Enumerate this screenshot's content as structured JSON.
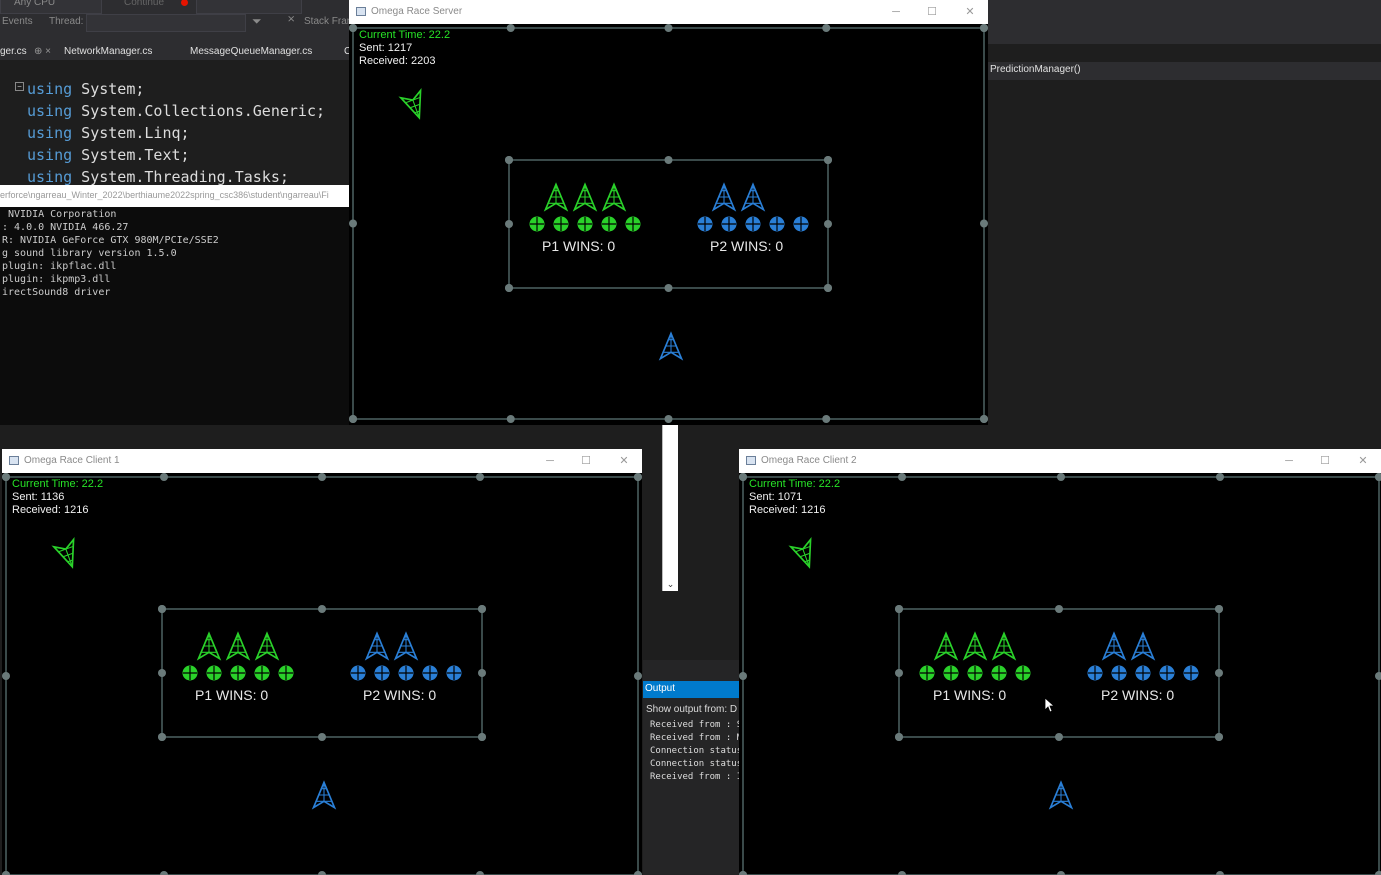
{
  "ide": {
    "toolbar": {
      "platform": "Any CPU",
      "continue": "Continue",
      "events": "Events",
      "thread": "Thread:",
      "stack_frame": "Stack Fran"
    },
    "tabs": [
      "ger.cs",
      "NetworkManager.cs",
      "MessageQueueManager.cs",
      "C"
    ],
    "nav_method": "PredictionManager()",
    "code_lines": [
      {
        "kw": "using",
        "rest": " System;"
      },
      {
        "kw": "using",
        "rest": " System.Collections.Generic;"
      },
      {
        "kw": "using",
        "rest": " System.Linq;"
      },
      {
        "kw": "using",
        "rest": " System.Text;"
      },
      {
        "kw": "using",
        "rest": " System.Threading.Tasks;"
      }
    ]
  },
  "console": {
    "path": "erforce\\ngarreau_Winter_2022\\berthiaume2022spring_csc386\\student\\ngarreau\\Fi",
    "lines": [
      " NVIDIA Corporation",
      ": 4.0.0 NVIDIA 466.27",
      "R: NVIDIA GeForce GTX 980M/PCIe/SSE2",
      "g sound library version 1.5.0",
      "plugin: ikpflac.dll",
      "plugin: ikpmp3.dll",
      "irectSound8 driver"
    ]
  },
  "output": {
    "title": "Output",
    "show_from": "Show output from:  D",
    "lines": [
      "Received from : S",
      "Received from : M",
      "Connection status",
      "Connection status",
      "Received from : I"
    ]
  },
  "windows": {
    "server": {
      "title": "Omega Race Server",
      "time": "Current Time: 22.2",
      "sent": "Sent: 1217",
      "received": "Received: 2203",
      "p1_wins": "P1 WINS: 0",
      "p2_wins": "P2 WINS: 0"
    },
    "client1": {
      "title": "Omega Race Client 1",
      "time": "Current Time: 22.2",
      "sent": "Sent: 1136",
      "received": "Received: 1216",
      "p1_wins": "P1 WINS: 0",
      "p2_wins": "P2 WINS: 0"
    },
    "client2": {
      "title": "Omega Race Client 2",
      "time": "Current Time: 22.2",
      "sent": "Sent: 1071",
      "received": "Received: 1216",
      "p1_wins": "P1 WINS: 0",
      "p2_wins": "P2 WINS: 0"
    }
  },
  "colors": {
    "p1": "#2ad12a",
    "p2": "#2a7fd6",
    "arena": "#3a4a4a"
  },
  "icons": {
    "window_controls": [
      "minimize-icon",
      "maximize-icon",
      "close-icon"
    ],
    "ship": "ship-icon",
    "mine": "mine-icon"
  }
}
